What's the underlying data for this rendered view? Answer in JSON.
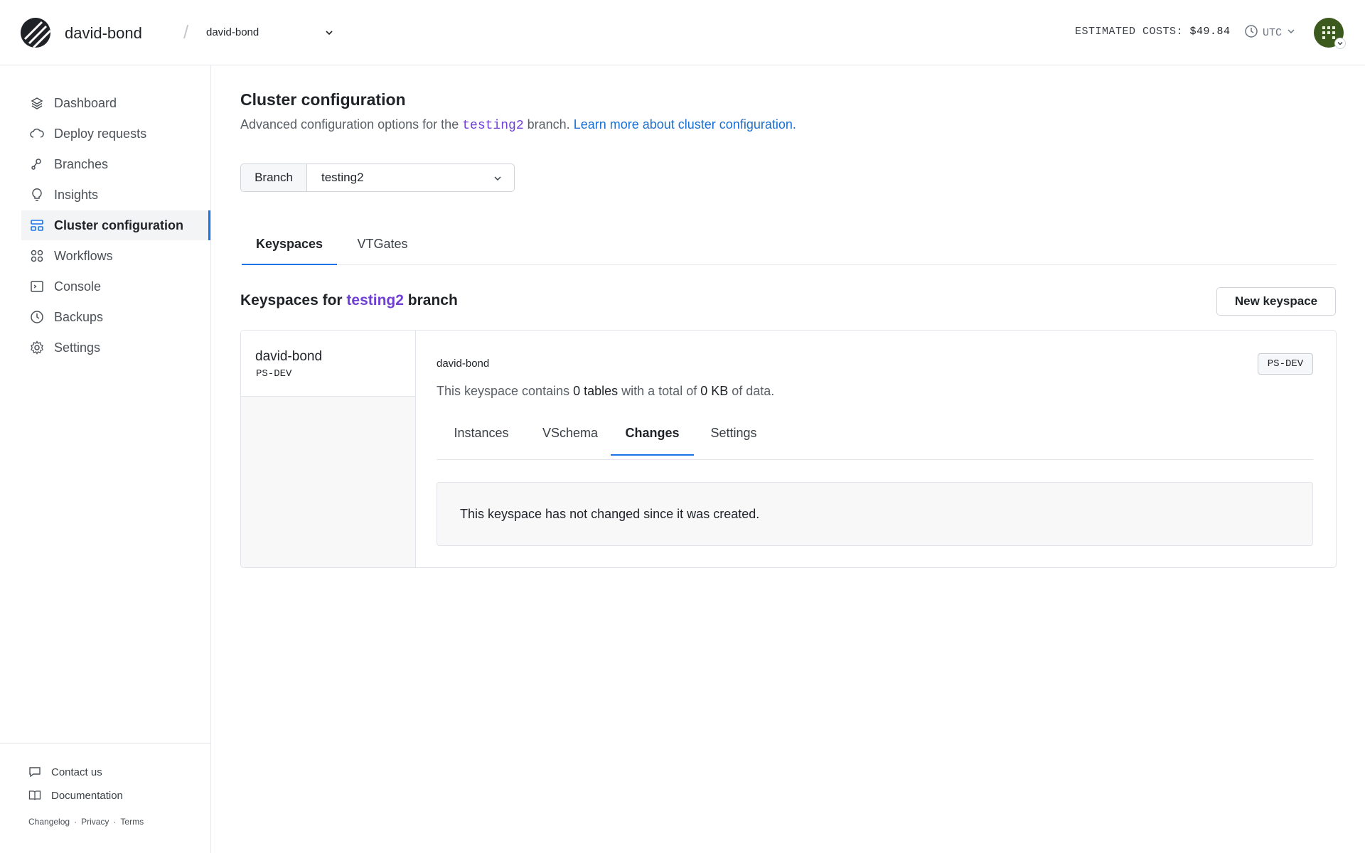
{
  "header": {
    "org_name": "david-bond",
    "separator": "/",
    "database": "david-bond",
    "estimated_costs_label": "ESTIMATED COSTS:",
    "estimated_costs_value": "$49.84",
    "timezone": "UTC",
    "avatar_color": "#3d5a1e"
  },
  "sidebar": {
    "items": [
      {
        "label": "Dashboard",
        "icon": "layers-icon"
      },
      {
        "label": "Deploy requests",
        "icon": "cloud-icon"
      },
      {
        "label": "Branches",
        "icon": "branch-icon"
      },
      {
        "label": "Insights",
        "icon": "lightbulb-icon"
      },
      {
        "label": "Cluster configuration",
        "icon": "cluster-icon",
        "active": true
      },
      {
        "label": "Workflows",
        "icon": "workflow-icon"
      },
      {
        "label": "Console",
        "icon": "terminal-icon"
      },
      {
        "label": "Backups",
        "icon": "clock-icon"
      },
      {
        "label": "Settings",
        "icon": "gear-icon"
      }
    ],
    "footer": {
      "contact": "Contact us",
      "documentation": "Documentation",
      "changelog": "Changelog",
      "privacy": "Privacy",
      "terms": "Terms",
      "dot": "·"
    }
  },
  "main": {
    "title": "Cluster configuration",
    "subtitle_prefix": "Advanced configuration options for the ",
    "subtitle_branch": "testing2",
    "subtitle_suffix": " branch. ",
    "subtitle_link": "Learn more about cluster configuration.",
    "branch_label": "Branch",
    "branch_value": "testing2",
    "tabs": [
      "Keyspaces",
      "VTGates"
    ],
    "active_tab": "Keyspaces",
    "keyspaces_heading_prefix": "Keyspaces for ",
    "keyspaces_heading_branch": "testing2",
    "keyspaces_heading_suffix": " branch",
    "new_keyspace_button": "New keyspace",
    "keyspace": {
      "name": "david-bond",
      "cluster_size": "PS-DEV",
      "desc_prefix": "This keyspace contains ",
      "tables": "0 tables",
      "desc_middle": " with a total of ",
      "size": "0 KB",
      "desc_suffix": " of data.",
      "tabs": [
        "Instances",
        "VSchema",
        "Changes",
        "Settings"
      ],
      "active_tab": "Changes",
      "changes_message": "This keyspace has not changed since it was created."
    }
  },
  "colors": {
    "accent": "#1a73e8",
    "branch_purple": "#6f3fd6",
    "link_blue": "#1a6fd0"
  }
}
